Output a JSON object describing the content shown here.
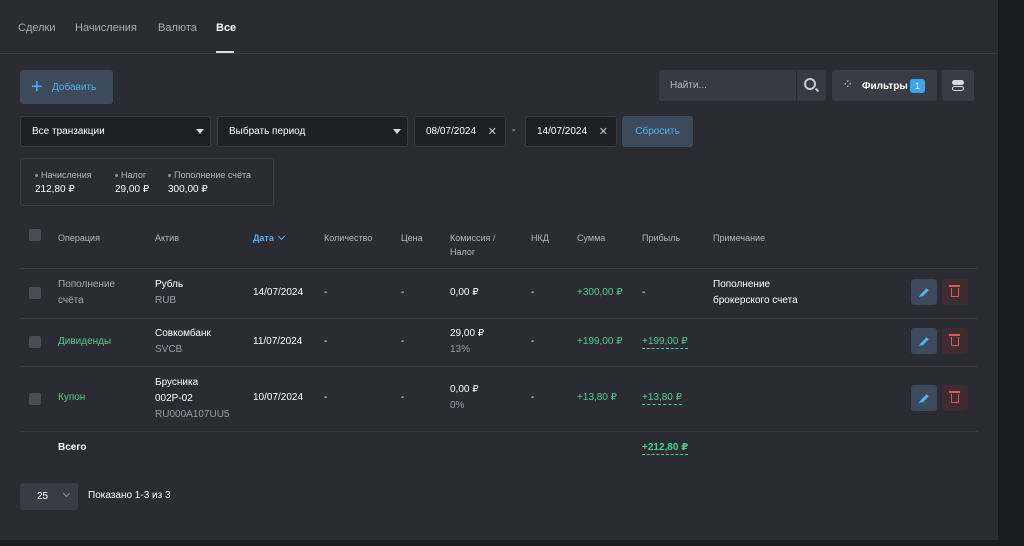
{
  "tabs": [
    "Сделки",
    "Начисления",
    "Валюта",
    "Все"
  ],
  "toolbar": {
    "add_label": "Добавить",
    "search_placeholder": "Найти...",
    "filters_label": "Фильтры",
    "filters_count": "1"
  },
  "filters": {
    "type_value": "Все транзакции",
    "period_value": "Выбрать период",
    "date_from": "08/07/2024",
    "date_to": "14/07/2024",
    "dash": "-",
    "reset_label": "Сбросить"
  },
  "summary": [
    {
      "label": "Начисления",
      "value": "212,80 ₽"
    },
    {
      "label": "Налог",
      "value": "29,00 ₽"
    },
    {
      "label": "Пополнение счёта",
      "value": "300,00 ₽"
    }
  ],
  "table": {
    "headers": {
      "operation": "Операция",
      "asset": "Актив",
      "date": "Дата",
      "quantity": "Количество",
      "price": "Цена",
      "commission_1": "Комиссия /",
      "commission_2": "Налог",
      "nkd": "НКД",
      "sum": "Сумма",
      "profit": "Прибыль",
      "note": "Примечание"
    },
    "rows": [
      {
        "op_1": "Пополнение",
        "op_2": "счёта",
        "asset_name": "Рубль",
        "asset_code": "RUB",
        "date": "14/07/2024",
        "quantity": "-",
        "price": "-",
        "commission": "0,00 ₽",
        "nkd": "-",
        "sum": "+300,00 ₽",
        "profit": "-",
        "note_1": "Пополнение",
        "note_2": "брокерского счета"
      },
      {
        "op": "Дивиденды",
        "asset_name": "Совкомбанк",
        "asset_code": "SVCB",
        "date": "11/07/2024",
        "quantity": "-",
        "price": "-",
        "commission": "29,00 ₽",
        "tax_rate": "13%",
        "nkd": "-",
        "sum": "+199,00 ₽",
        "profit": "+199,00 ₽"
      },
      {
        "op": "Купон",
        "asset_name_1": "Брусника",
        "asset_name_2": "002P-02",
        "asset_code": "RU000A107UU5",
        "date": "10/07/2024",
        "quantity": "-",
        "price": "-",
        "commission": "0,00 ₽",
        "tax_rate": "0%",
        "nkd": "-",
        "sum": "+13,80 ₽",
        "profit": "+13,80 ₽"
      }
    ],
    "total_label": "Всего",
    "total_profit": "+212,80 ₽"
  },
  "pagination": {
    "page_size": "25",
    "shown_text": "Показано 1-3 из 3"
  },
  "colors": {
    "accent": "#4fb3f6",
    "positive": "#4fd08a",
    "danger": "#e0585a",
    "background": "#2a2b33"
  }
}
